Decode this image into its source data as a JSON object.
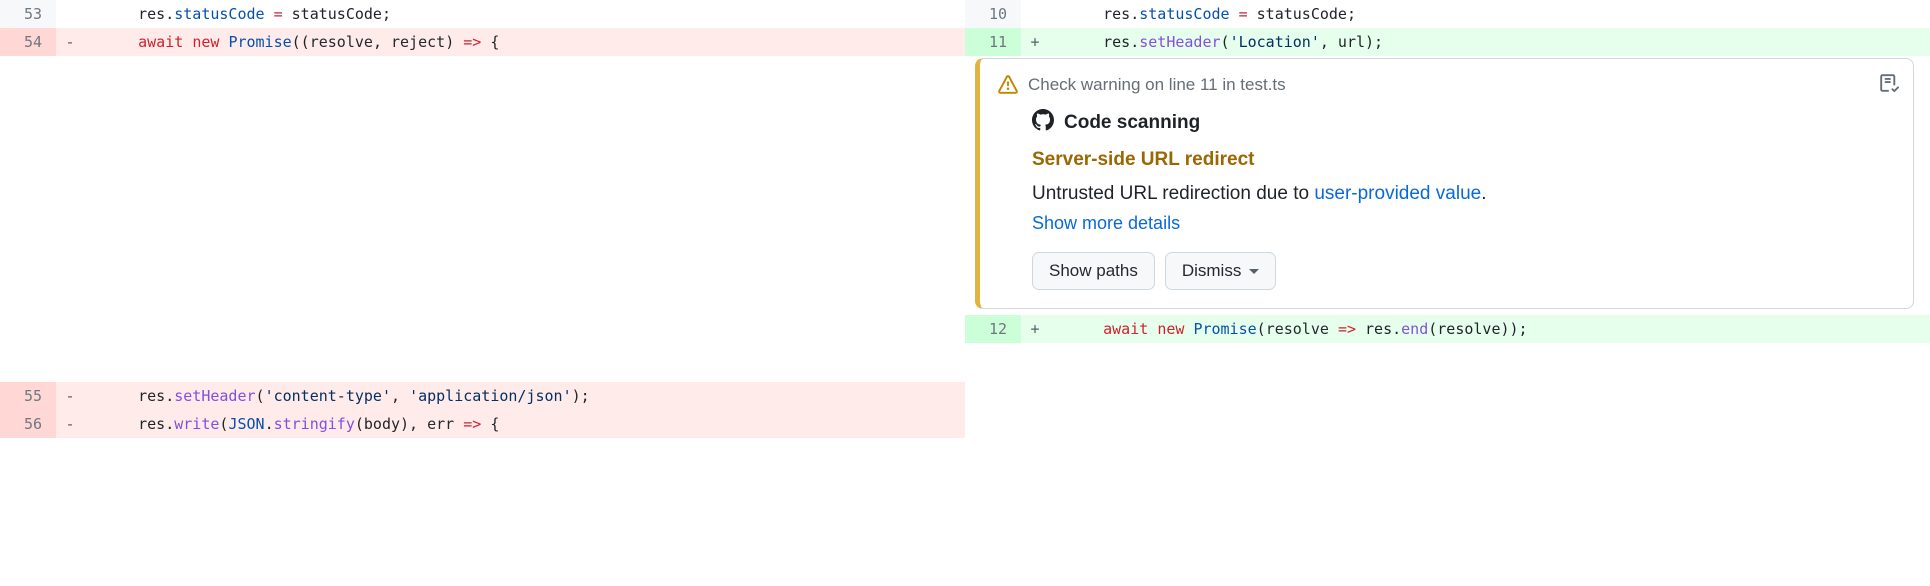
{
  "left": {
    "rows": [
      {
        "num": "53",
        "marker": "",
        "cls": "ctx",
        "tokens": [
          {
            "t": "    res.",
            "c": ""
          },
          {
            "t": "statusCode",
            "c": "prop"
          },
          {
            "t": " ",
            "c": ""
          },
          {
            "t": "=",
            "c": "kw"
          },
          {
            "t": " statusCode;",
            "c": ""
          }
        ]
      },
      {
        "num": "54",
        "marker": "-",
        "cls": "del",
        "tokens": [
          {
            "t": "    ",
            "c": ""
          },
          {
            "t": "await",
            "c": "kw"
          },
          {
            "t": " ",
            "c": ""
          },
          {
            "t": "new",
            "c": "kw"
          },
          {
            "t": " ",
            "c": ""
          },
          {
            "t": "Promise",
            "c": "const"
          },
          {
            "t": "((",
            "c": ""
          },
          {
            "t": "resolve",
            "c": "var"
          },
          {
            "t": ", ",
            "c": ""
          },
          {
            "t": "reject",
            "c": "var"
          },
          {
            "t": ") ",
            "c": ""
          },
          {
            "t": "=>",
            "c": "kw"
          },
          {
            "t": " {",
            "c": ""
          }
        ]
      },
      {
        "num": "55",
        "marker": "-",
        "cls": "del",
        "tokens": [
          {
            "t": "    res.",
            "c": ""
          },
          {
            "t": "setHeader",
            "c": "fn"
          },
          {
            "t": "(",
            "c": ""
          },
          {
            "t": "'content-type'",
            "c": "str"
          },
          {
            "t": ", ",
            "c": ""
          },
          {
            "t": "'application/json'",
            "c": "str"
          },
          {
            "t": ");",
            "c": ""
          }
        ]
      },
      {
        "num": "56",
        "marker": "-",
        "cls": "del",
        "tokens": [
          {
            "t": "    res.",
            "c": ""
          },
          {
            "t": "write",
            "c": "fn"
          },
          {
            "t": "(",
            "c": ""
          },
          {
            "t": "JSON",
            "c": "const"
          },
          {
            "t": ".",
            "c": ""
          },
          {
            "t": "stringify",
            "c": "fn"
          },
          {
            "t": "(body), ",
            "c": ""
          },
          {
            "t": "err",
            "c": "var"
          },
          {
            "t": " ",
            "c": ""
          },
          {
            "t": "=>",
            "c": "kw"
          },
          {
            "t": " {",
            "c": ""
          }
        ]
      }
    ]
  },
  "right": {
    "rows": [
      {
        "num": "10",
        "marker": "",
        "cls": "ctx",
        "tokens": [
          {
            "t": "    res.",
            "c": ""
          },
          {
            "t": "statusCode",
            "c": "prop"
          },
          {
            "t": " ",
            "c": ""
          },
          {
            "t": "=",
            "c": "kw"
          },
          {
            "t": " statusCode;",
            "c": ""
          }
        ]
      },
      {
        "num": "11",
        "marker": "+",
        "cls": "add",
        "tokens": [
          {
            "t": "    res.",
            "c": ""
          },
          {
            "t": "setHeader",
            "c": "fn"
          },
          {
            "t": "(",
            "c": ""
          },
          {
            "t": "'Location'",
            "c": "str"
          },
          {
            "t": ", url);",
            "c": ""
          }
        ]
      },
      {
        "num": "12",
        "marker": "+",
        "cls": "add",
        "tokens": [
          {
            "t": "    ",
            "c": ""
          },
          {
            "t": "await",
            "c": "kw"
          },
          {
            "t": " ",
            "c": ""
          },
          {
            "t": "new",
            "c": "kw"
          },
          {
            "t": " ",
            "c": ""
          },
          {
            "t": "Promise",
            "c": "const"
          },
          {
            "t": "(",
            "c": ""
          },
          {
            "t": "resolve",
            "c": "var"
          },
          {
            "t": " ",
            "c": ""
          },
          {
            "t": "=>",
            "c": "kw"
          },
          {
            "t": " res.",
            "c": ""
          },
          {
            "t": "end",
            "c": "fn"
          },
          {
            "t": "(resolve));",
            "c": ""
          }
        ]
      }
    ]
  },
  "alert": {
    "check_label": "Check warning on line 11 in test.ts",
    "provider": "Code scanning",
    "title": "Server-side URL redirect",
    "desc_pre": "Untrusted URL redirection due to ",
    "desc_link": "user-provided value",
    "desc_post": ".",
    "show_more": "Show more details",
    "btn_paths": "Show paths",
    "btn_dismiss": "Dismiss"
  }
}
